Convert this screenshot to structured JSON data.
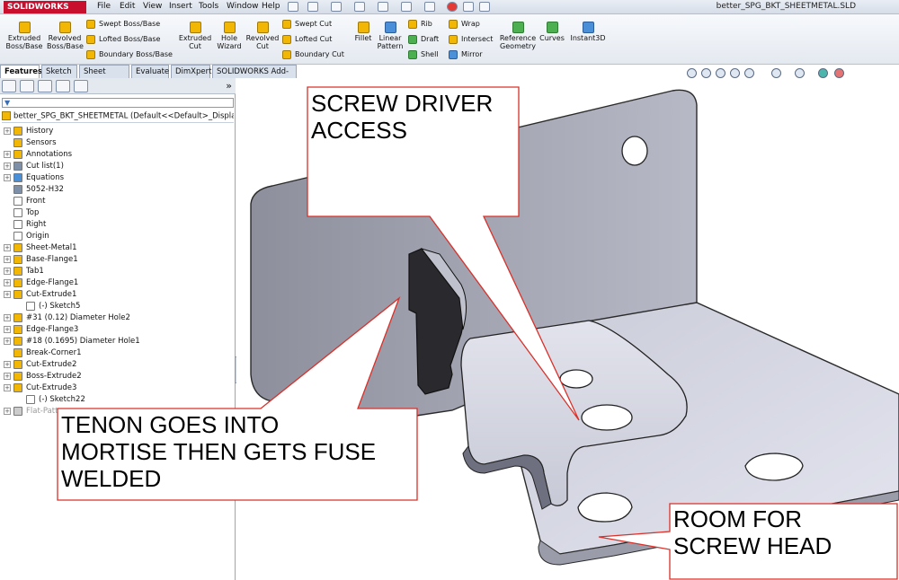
{
  "app": {
    "logo_text": "SOLIDWORKS",
    "window_title": "better_SPG_BKT_SHEETMETAL.SLD",
    "brand_color": "#c8102e"
  },
  "menu": [
    "File",
    "Edit",
    "View",
    "Insert",
    "Tools",
    "Window",
    "Help"
  ],
  "commands": {
    "extruded_boss": "Extruded\nBoss/Base",
    "revolved_boss": "Revolved\nBoss/Base",
    "swept_boss": "Swept Boss/Base",
    "lofted_boss": "Lofted Boss/Base",
    "boundary_boss": "Boundary Boss/Base",
    "extruded_cut": "Extruded\nCut",
    "hole_wizard": "Hole\nWizard",
    "revolved_cut": "Revolved\nCut",
    "swept_cut": "Swept Cut",
    "lofted_cut": "Lofted Cut",
    "boundary_cut": "Boundary Cut",
    "fillet": "Fillet",
    "linear_pattern": "Linear\nPattern",
    "rib": "Rib",
    "draft": "Draft",
    "shell": "Shell",
    "wrap": "Wrap",
    "intersect": "Intersect",
    "mirror": "Mirror",
    "reference_geometry": "Reference\nGeometry",
    "curves": "Curves",
    "instant3d": "Instant3D"
  },
  "tabs": [
    "Features",
    "Sketch",
    "Sheet Metal",
    "Evaluate",
    "DimXpert",
    "SOLIDWORKS Add-Ins"
  ],
  "tree": {
    "root": "better_SPG_BKT_SHEETMETAL  (Default<<Default>_Display Stat",
    "items": [
      {
        "label": "History",
        "icon": "history-icon",
        "expandable": true
      },
      {
        "label": "Sensors",
        "icon": "sensor-icon",
        "expandable": false
      },
      {
        "label": "Annotations",
        "icon": "annotation-icon",
        "expandable": true
      },
      {
        "label": "Cut list(1)",
        "icon": "cutlist-icon",
        "expandable": true
      },
      {
        "label": "Equations",
        "icon": "equation-icon",
        "expandable": true
      },
      {
        "label": "5052-H32",
        "icon": "material-icon",
        "expandable": false
      },
      {
        "label": "Front",
        "icon": "plane-icon",
        "expandable": false
      },
      {
        "label": "Top",
        "icon": "plane-icon",
        "expandable": false
      },
      {
        "label": "Right",
        "icon": "plane-icon",
        "expandable": false
      },
      {
        "label": "Origin",
        "icon": "origin-icon",
        "expandable": false
      },
      {
        "label": "Sheet-Metal1",
        "icon": "sheetmetal-icon",
        "expandable": true
      },
      {
        "label": "Base-Flange1",
        "icon": "flange-icon",
        "expandable": true
      },
      {
        "label": "Tab1",
        "icon": "tab-icon",
        "expandable": true
      },
      {
        "label": "Edge-Flange1",
        "icon": "edgeflange-icon",
        "expandable": true
      },
      {
        "label": "Cut-Extrude1",
        "icon": "cut-icon",
        "expandable": true
      },
      {
        "label": "(-) Sketch5",
        "icon": "sketch-icon",
        "expandable": false,
        "indent": true
      },
      {
        "label": "#31 (0.12) Diameter Hole2",
        "icon": "hole-icon",
        "expandable": true
      },
      {
        "label": "Edge-Flange3",
        "icon": "edgeflange-icon",
        "expandable": true
      },
      {
        "label": "#18 (0.1695) Diameter Hole1",
        "icon": "hole-icon",
        "expandable": true
      },
      {
        "label": "Break-Corner1",
        "icon": "corner-icon",
        "expandable": false
      },
      {
        "label": "Cut-Extrude2",
        "icon": "cut-icon",
        "expandable": true
      },
      {
        "label": "Boss-Extrude2",
        "icon": "boss-icon",
        "expandable": true
      },
      {
        "label": "Cut-Extrude3",
        "icon": "cut-icon",
        "expandable": true
      },
      {
        "label": "(-) Sketch22",
        "icon": "sketch-icon",
        "expandable": false,
        "indent": true
      },
      {
        "label": "Flat-Patt",
        "icon": "flat-icon",
        "expandable": true,
        "dim": true
      }
    ]
  },
  "callouts": {
    "screwdriver": [
      "SCREW DRIVER",
      "ACCESS"
    ],
    "tenon": [
      "TENON GOES INTO",
      "MORTISE THEN GETS FUSE",
      "WELDED"
    ],
    "room": [
      "ROOM FOR",
      "SCREW HEAD"
    ],
    "border_color": "#d9302a"
  }
}
